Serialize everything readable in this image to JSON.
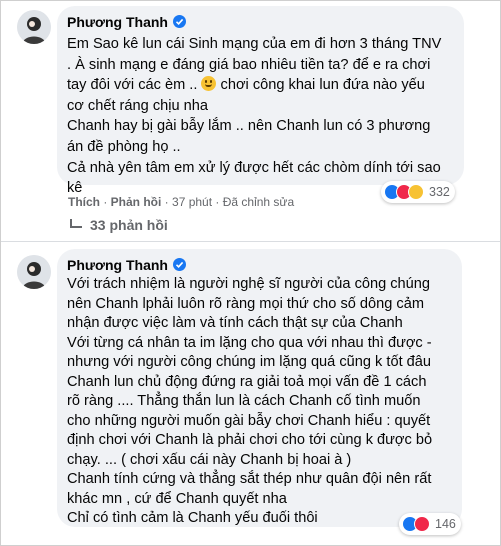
{
  "comments": [
    {
      "author": "Phương Thanh",
      "lines": [
        "Em Sao kê lun cái Sinh mạng của em đi hơn 3 tháng TNV",
        ". À sinh mạng e đáng giá bao nhiêu tiền ta? để e ra chơi",
        "tay đôi với các èm ..",
        " chơi công khai lun đứa nào yếu",
        "cơ chết ráng chịu nha",
        "Chanh hay bị gài bẫy lắm .. nên Chanh lun có 3 phương",
        "án đề phòng họ ..",
        "Cả nhà yên tâm em xử lý được hết các chòm dính tới sao",
        "kê"
      ],
      "like_label": "Thích",
      "reply_label": "Phản hồi",
      "time": "37 phút",
      "edited": "Đã chỉnh sửa",
      "reaction_count": "332"
    },
    {
      "author": "Phương Thanh",
      "lines": [
        "Với trách nhiệm là người nghệ sĩ người của công chúng",
        "nên Chanh lphải luôn rõ ràng mọi thứ cho số dông cảm",
        "nhận được việc làm và tính cách thật sự của Chanh",
        "Với từng cá nhân ta im lặng cho qua với nhau thì được -",
        "nhưng với người công chúng im lặng quá cũng k tốt đâu",
        "Chanh lun chủ động đứng ra giải toả mọi vấn đề 1 cách",
        "rõ ràng .... Thẳng thắn lun là cách Chanh cố tình muốn",
        "cho những người muốn gài bẫy chơi Chanh hiểu : quyết",
        "định chơi với Chanh là phải chơi cho tới cùng k được bỏ",
        "chạy. ... ( chơi xấu cái này Chanh bị hoai à )",
        "Chanh tính cứng và thẳng sắt thép như quân đội nên rất",
        "khác mn , cứ để Chanh quyết nha",
        "Chỉ có tình cảm là Chanh yếu đuối thôi"
      ],
      "reaction_count": "146"
    }
  ],
  "replies_link": "33 phản hồi",
  "icons": {
    "verified": "verified-badge-icon",
    "emoji": "smiling-face-emoji",
    "reactions": [
      "like-reaction-icon",
      "love-reaction-icon",
      "care-reaction-icon"
    ],
    "replies_arrow": "reply-arrow-icon"
  },
  "colors": {
    "bubble": "#f0f2f5",
    "verified": "#1877f2",
    "meta": "#65676b"
  }
}
